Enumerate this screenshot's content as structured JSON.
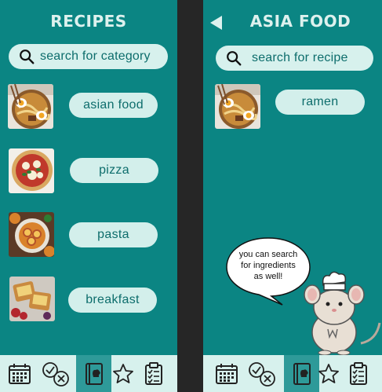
{
  "left_screen": {
    "title": "RECIPES",
    "search": {
      "placeholder": "search for category"
    },
    "categories": [
      {
        "label": "asian food"
      },
      {
        "label": "pizza"
      },
      {
        "label": "pasta"
      },
      {
        "label": "breakfast"
      }
    ]
  },
  "right_screen": {
    "title": "ASIA FOOD",
    "search": {
      "placeholder": "search for recipe"
    },
    "recipes": [
      {
        "label": "ramen"
      }
    ],
    "tip": {
      "line1": "you can search",
      "line2": "for ingredients",
      "line3": "as well!"
    }
  },
  "bottom_nav": {
    "items": [
      "calendar-icon",
      "check-cross-icon",
      "recipe-book-icon",
      "star-icon",
      "clipboard-checklist-icon"
    ],
    "active": "recipe-book-icon"
  },
  "colors": {
    "background": "#0b8583",
    "pill": "#d3efeb",
    "text_dark": "#0d6d6c",
    "title": "#ddf1ee",
    "nav_active": "#2e9a99"
  }
}
